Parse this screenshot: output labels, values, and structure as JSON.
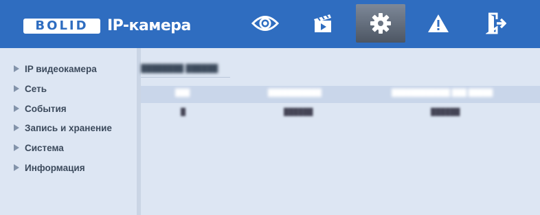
{
  "header": {
    "logo_text": "BOLID",
    "product_title": "IP-камера",
    "nav": [
      {
        "name": "live-view",
        "icon": "eye-icon"
      },
      {
        "name": "playback",
        "icon": "clapperboard-icon"
      },
      {
        "name": "settings",
        "icon": "gear-icon",
        "active": true
      },
      {
        "name": "alarms",
        "icon": "warning-icon"
      },
      {
        "name": "logout",
        "icon": "exit-icon"
      }
    ]
  },
  "sidebar": {
    "items": [
      {
        "label": "IP видеокамера"
      },
      {
        "label": "Сеть"
      },
      {
        "label": "События"
      },
      {
        "label": "Запись и хранение"
      },
      {
        "label": "Система"
      },
      {
        "label": "Информация"
      }
    ]
  },
  "colors": {
    "header_bg": "#2f6dc0",
    "page_bg": "#dde6f3",
    "active_tab": "#5a6472"
  }
}
